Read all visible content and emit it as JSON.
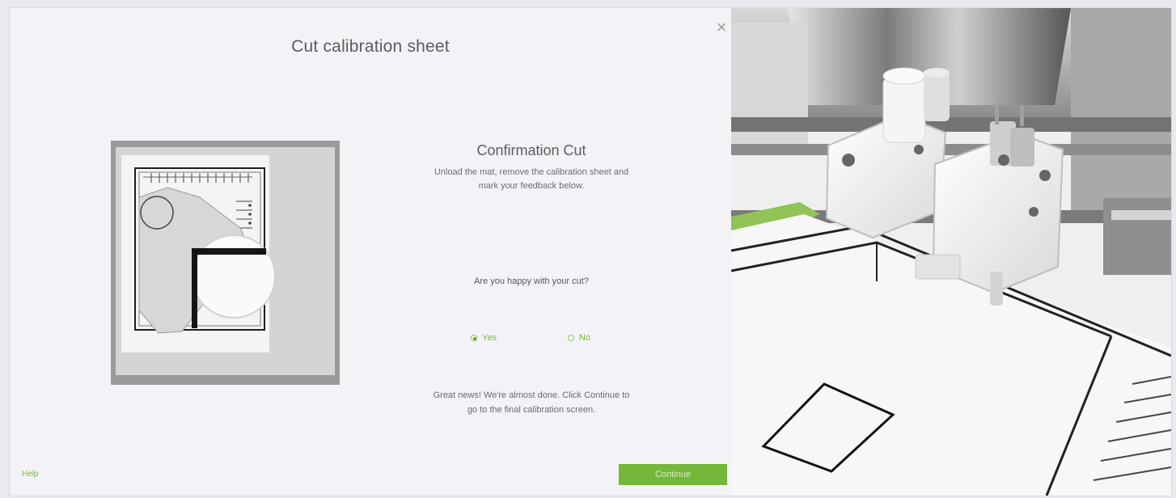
{
  "dialog": {
    "title": "Cut calibration sheet",
    "close_icon": "close-icon"
  },
  "content": {
    "heading": "Confirmation Cut",
    "instructions_line1": "Unload the mat, remove the calibration sheet and",
    "instructions_line2": "mark your feedback below.",
    "question": "Are you happy with your cut?",
    "options": [
      {
        "label": "Yes",
        "selected": true
      },
      {
        "label": "No",
        "selected": false
      }
    ],
    "message_line1": "Great news! We're almost done. Click Continue to",
    "message_line2": "go to the final calibration screen."
  },
  "footer": {
    "help": "Help",
    "continue": "Continue"
  },
  "colors": {
    "accent": "#74b73a",
    "panel_bg": "#f3f3f7"
  }
}
